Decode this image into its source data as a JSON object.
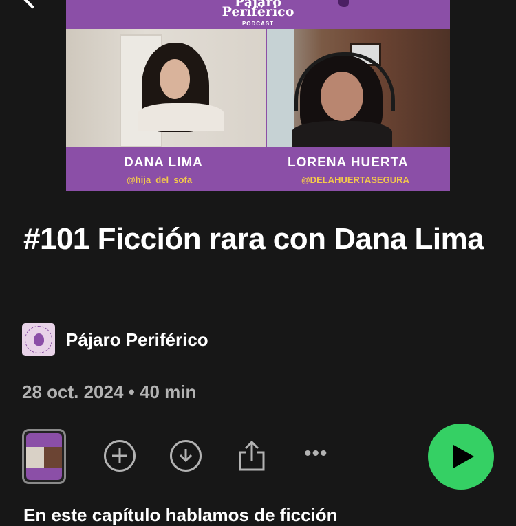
{
  "cover": {
    "brand_line1": "Pájaro",
    "brand_line2": "Periférico",
    "brand_sub": "PODCAST",
    "guest1_name": "DANA LIMA",
    "guest1_handle": "@hija_del_sofa",
    "guest2_name": "LORENA HUERTA",
    "guest2_handle": "@DELAHUERTASEGURA"
  },
  "episode": {
    "title": "#101 Ficción rara con Dana Lima",
    "show_name": "Pájaro Periférico",
    "date": "28 oct. 2024",
    "duration": "40 min",
    "meta": "28 oct. 2024 • 40 min"
  },
  "actions": {
    "add_icon": "plus-circle-icon",
    "download_icon": "download-icon",
    "share_icon": "share-icon",
    "more_icon": "more-icon",
    "more_label": "•••",
    "play_icon": "play-icon"
  },
  "description_partial": "En este capítulo hablamos de ficción",
  "colors": {
    "background": "#171717",
    "accent_purple": "#8b4fa7",
    "play_green": "#35d064",
    "muted_text": "#b3b3b3",
    "handle_yellow": "#f3c94b"
  }
}
